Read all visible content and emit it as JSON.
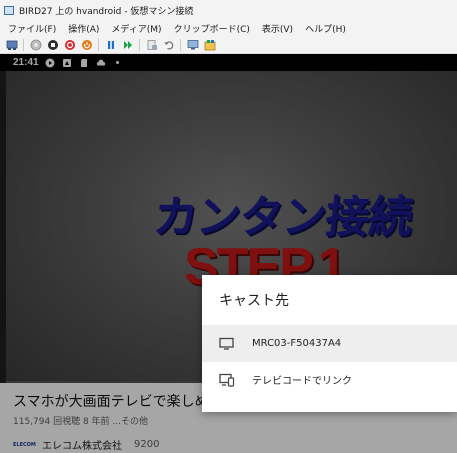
{
  "window": {
    "title": "BIRD27 上の hvandroid - 仮想マシン接続"
  },
  "menu": {
    "items": [
      {
        "label": "ファイル(F)"
      },
      {
        "label": "操作(A)"
      },
      {
        "label": "メディア(M)"
      },
      {
        "label": "クリップボード(C)"
      },
      {
        "label": "表示(V)"
      },
      {
        "label": "ヘルプ(H)"
      }
    ]
  },
  "toolbar": {
    "icons": [
      "ctrl-alt-del-icon",
      "start-icon",
      "turn-off-icon",
      "shutdown-icon",
      "power-icon",
      "pause-icon",
      "resume-icon",
      "checkpoint-icon",
      "revert-icon",
      "enhanced-session-icon",
      "share-icon"
    ]
  },
  "android": {
    "status_time": "21:41"
  },
  "video": {
    "overlay_line1": "カンタン接続",
    "overlay_line2": "STEP.1",
    "title": "スマホが大画面テレビで楽しめる、",
    "meta": "115,794 回視聴  8 年前  ...その他",
    "channel_name": "エレコム株式会社",
    "channel_subs": "9200",
    "channel_logo_text": "ELECOM"
  },
  "cast_dialog": {
    "title": "キャスト先",
    "devices": [
      {
        "label": "MRC03-F50437A4",
        "icon": "tv-icon",
        "selected": true
      },
      {
        "label": "テレビコードでリンク",
        "icon": "tv-code-link-icon",
        "selected": false
      }
    ]
  },
  "colors": {
    "overlay_text_blue": "#1b1d8c",
    "overlay_text_red": "#c41a1a",
    "toolbar_green": "#1aa34a",
    "toolbar_red": "#d9262a",
    "toolbar_orange": "#e07a12",
    "toolbar_blue": "#1f6fd1"
  }
}
